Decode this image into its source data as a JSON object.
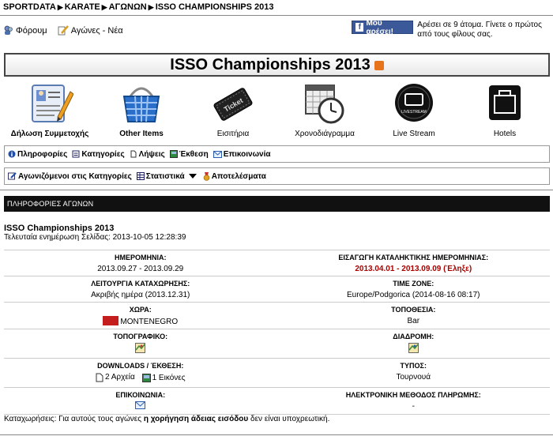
{
  "breadcrumb": [
    "SPORTDATA",
    "KARATE",
    "ΑΓΩΝΩΝ",
    "ISSO CHAMPIONSHIPS 2013"
  ],
  "toplinks": {
    "forum": "Φόρουμ",
    "news": "Αγώνες - Νέα"
  },
  "facebook": {
    "button": "Μου αρέσει!",
    "text": "Αρέσει σε 9 άτομα. Γίνετε ο πρώτος από τους φίλους σας."
  },
  "title": "ISSO Championships 2013",
  "icons": [
    {
      "label": "Δήλωση Συμμετοχής",
      "icon": "registration-form-icon"
    },
    {
      "label": "Other Items",
      "icon": "shopping-basket-icon"
    },
    {
      "label": "Εισιτήρια",
      "icon": "ticket-icon"
    },
    {
      "label": "Χρονοδιάγραμμα",
      "icon": "schedule-clock-icon"
    },
    {
      "label": "Live Stream",
      "icon": "livestream-icon"
    },
    {
      "label": "Hotels",
      "icon": "suitcase-icon"
    }
  ],
  "menu1": [
    "Πληροφορίες",
    "Κατηγορίες",
    "Λήψεις",
    "Έκθεση",
    "Επικοινωνία"
  ],
  "menu2": [
    "Αγωνιζόμενοι στις Κατηγορίες",
    "Στατιστικά",
    "Αποτελέσματα"
  ],
  "section_header": "ΠΛΗΡΟΦΟΡΙΕΣ ΑΓΩΝΩΝ",
  "event_title": "ISSO Championships 2013",
  "last_update": "Τελευταία ενημέρωση Σελίδας: 2013-10-05 12:28:39",
  "info": {
    "date_label": "ΗΜΕΡΟΜΗΝΙΑ:",
    "date_value": "2013.09.27 - 2013.09.29",
    "deadline_label": "ΕΙΣΑΓΩΓΗ ΚΑΤΑΛΗΚΤΙΚΗΣ ΗΜΕΡΟΜΗΝΙΑΣ:",
    "deadline_value": "2013.04.01 - 2013.09.09 (Έληξε)",
    "regmode_label": "ΛΕΙΤΟΥΡΓΙΑ ΚΑΤΑΧΩΡΗΣΗΣ:",
    "regmode_value": "Ακριβής ημέρα (2013.12.31)",
    "timezone_label": "TIME ZONE:",
    "timezone_value": "Europe/Podgorica (2014-08-16 08:17)",
    "country_label": "ΧΩΡΑ:",
    "country_value": "MONTENEGRO",
    "location_label": "ΤΟΠΟΘΕΣΙΑ:",
    "location_value": "Bar",
    "map_label": "ΤΟΠΟΓΡΑΦΙΚΟ:",
    "route_label": "ΔΙΑΔΡΟΜΗ:",
    "downloads_label": "DOWNLOADS / ΈΚΘΕΣΗ:",
    "downloads_files": "2 Αρχεία",
    "downloads_images": "1 Εικόνες",
    "type_label": "ΤΥΠΟΣ:",
    "type_value": "Τουρνουά",
    "contact_label": "ΕΠΙΚΟΙΝΩΝΙΑ:",
    "payment_label": "ΗΛΕΚΤΡΟΝΙΚΗ ΜΕΘΟΔΟΣ ΠΛΗΡΩΜΗΣ:",
    "payment_value": "-"
  },
  "footer": {
    "prefix": "Καταχωρήσεις: Για αυτούς τους αγώνες ",
    "bold": "η χορήγηση άδειας εισόδου",
    "suffix": " δεν είναι υποχρεωτική."
  },
  "colors": {
    "section_bg": "#111111",
    "deadline": "#aa0000",
    "facebook": "#3b5998",
    "flag": "#c41e1e"
  }
}
